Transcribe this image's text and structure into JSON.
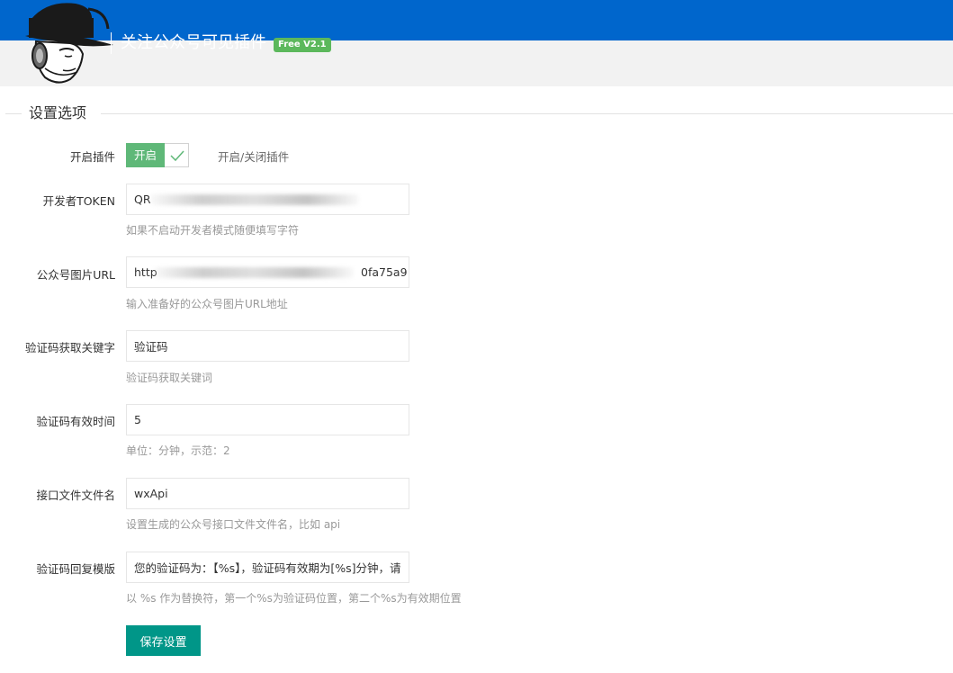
{
  "header": {
    "title": "关注公众号可见插件",
    "version_badge": "Free V2.1"
  },
  "section": {
    "title": "设置选项"
  },
  "enable_plugin": {
    "label": "开启插件",
    "switch_text": "开启",
    "description": "开启/关闭插件"
  },
  "fields": {
    "token": {
      "label": "开发者TOKEN",
      "value": "QR",
      "hint": "如果不启动开发者模式随便填写字符"
    },
    "image_url": {
      "label": "公众号图片URL",
      "value": "http",
      "value_tail": "0fa75a9",
      "hint": "输入准备好的公众号图片URL地址"
    },
    "keyword": {
      "label": "验证码获取关键字",
      "value": "验证码",
      "hint": "验证码获取关键词"
    },
    "expire_time": {
      "label": "验证码有效时间",
      "value": "5",
      "hint": "单位：分钟，示范：2"
    },
    "api_filename": {
      "label": "接口文件文件名",
      "value": "wxApi",
      "hint": "设置生成的公众号接口文件文件名，比如 api"
    },
    "reply_template": {
      "label": "验证码回复模版",
      "value": "您的验证码为：【%s】，验证码有效期为[%s]分钟，请",
      "hint": "以 %s 作为替换符，第一个%s为验证码位置，第二个%s为有效期位置"
    }
  },
  "save_button": {
    "label": "保存设置"
  },
  "colors": {
    "header_blue": "#0066cc",
    "switch_green": "#5fb878",
    "badge_green": "#5cb85c",
    "save_teal": "#009688"
  }
}
